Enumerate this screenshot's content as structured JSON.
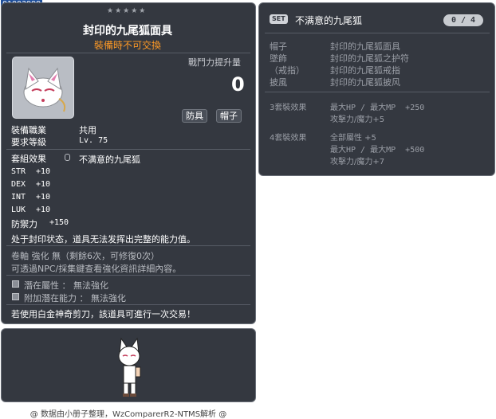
{
  "item_id": "01003999",
  "header": {
    "stars": "★★★★★",
    "title": "封印的九尾狐面具",
    "trade_note": "裝備時不可交換"
  },
  "power": {
    "label": "戰鬥力提升量",
    "value": "0"
  },
  "tags": [
    "防具",
    "帽子"
  ],
  "requirements": [
    {
      "label": "裝備職業",
      "value": "共用"
    },
    {
      "label": "要求等級",
      "value": "Lv. 75"
    }
  ],
  "set_effect": {
    "label": "套組效果",
    "value": "不满意的九尾狐"
  },
  "stats": [
    {
      "name": "STR",
      "value": "+10"
    },
    {
      "name": "DEX",
      "value": "+10"
    },
    {
      "name": "INT",
      "value": "+10"
    },
    {
      "name": "LUK",
      "value": "+10"
    }
  ],
  "defense": {
    "label": "防禦力",
    "value": "+150"
  },
  "sealed_note": "处于封印状态，道具无法发挥出完整的能力值。",
  "scroll": {
    "line1": "卷軸 強化 無（剩餘6次，可修復0次）",
    "line2": "可透過NPC/採集鍵查看強化資訊詳細內容。"
  },
  "potentials": [
    {
      "label": "潛在屬性 ： 無法強化"
    },
    {
      "label": "附加潛在能力 ： 無法強化"
    }
  ],
  "scissors_note": "若使用白金神奇剪刀，該道具可進行一次交易！",
  "footer": "@ 数据由小册子整理，WzComparerR2-NTMS解析 @",
  "set_panel": {
    "badge": "SET",
    "name": "不满意的九尾狐",
    "count": "0 / 4",
    "items": [
      {
        "category": "帽子",
        "name": "封印的九尾狐面具"
      },
      {
        "category": "墜飾",
        "name": "封印的九尾狐之护符"
      },
      {
        "category": "（戒指）",
        "name": "封印的九尾狐戒指"
      },
      {
        "category": "披風",
        "name": "封印的九尾狐披风"
      }
    ],
    "effects": [
      {
        "label": "3套裝效果",
        "lines": [
          "最大HP / 最大MP  +250",
          "攻擊力/魔力+5"
        ]
      },
      {
        "label": "4套裝效果",
        "lines": [
          "全部屬性 +5",
          "最大HP / 最大MP  +500",
          "攻擊力/魔力+7"
        ]
      }
    ]
  },
  "colors": {
    "panel_bg": "#343840",
    "accent_orange": "#ff9a25",
    "text_gray": "#9a9ea6"
  }
}
